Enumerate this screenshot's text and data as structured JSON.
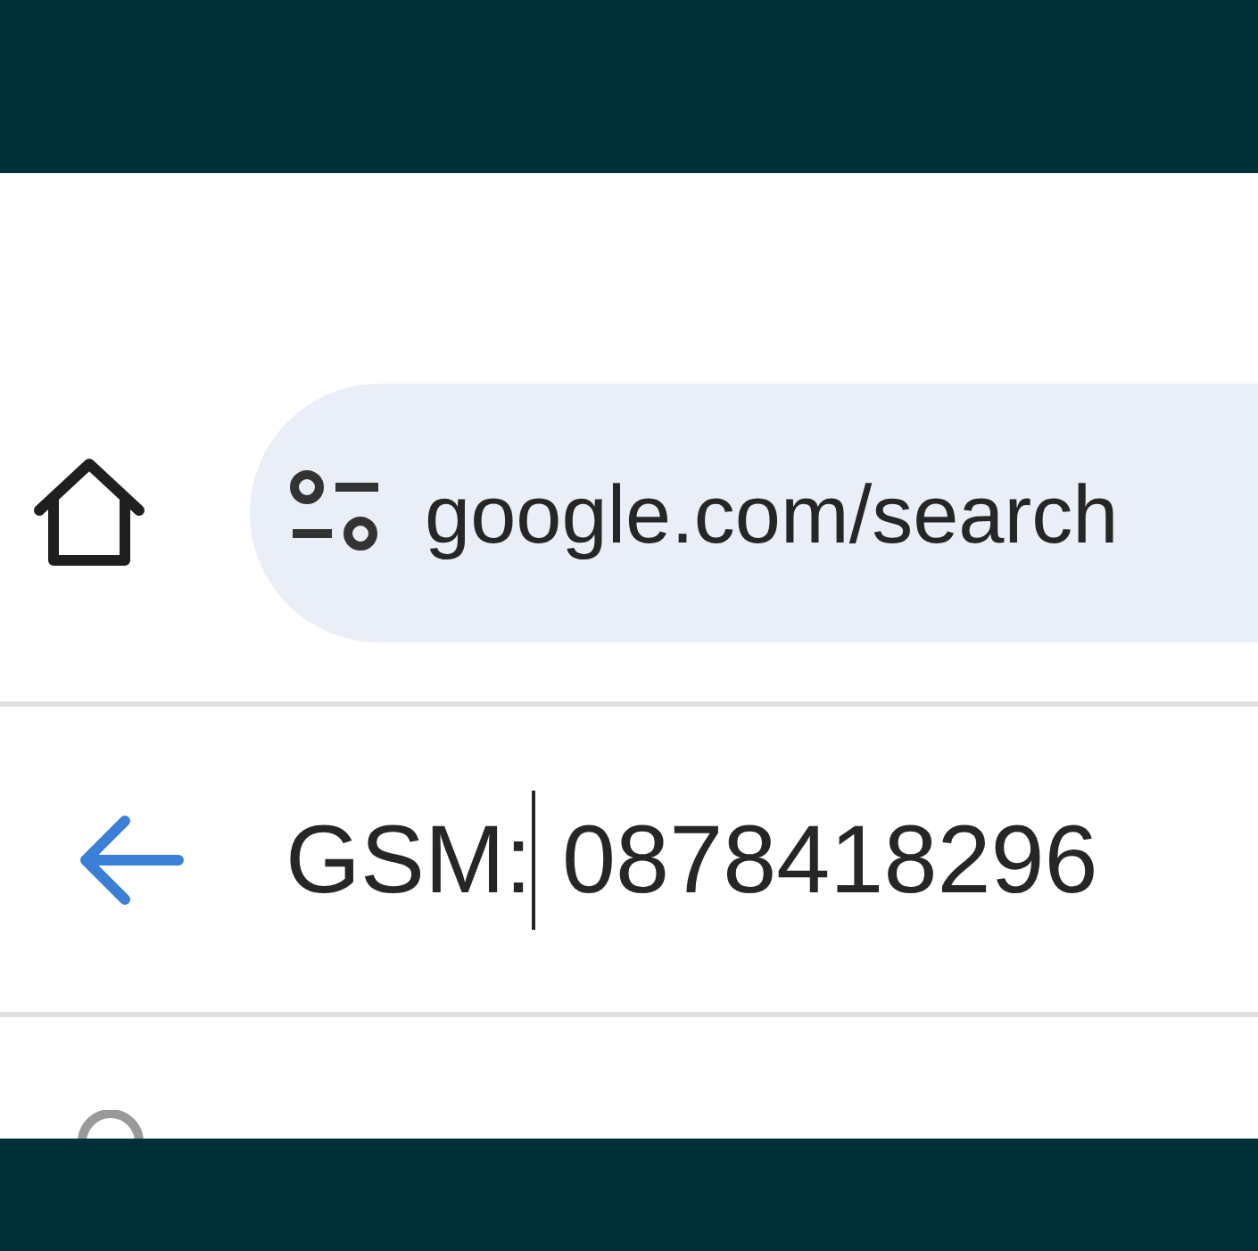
{
  "toolbar": {
    "url": "google.com/search"
  },
  "search_field": {
    "text_before_cursor": "GSM:",
    "text_after_cursor": " 0878418296"
  }
}
